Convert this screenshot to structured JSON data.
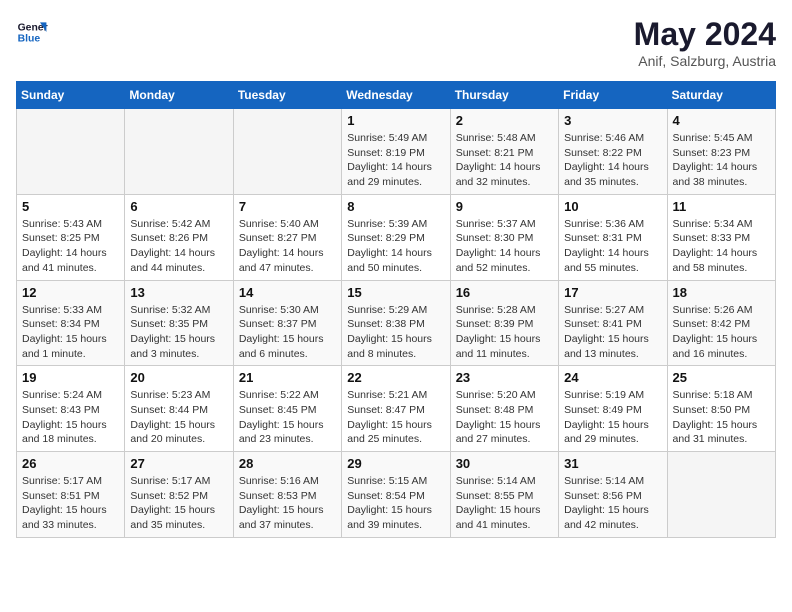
{
  "header": {
    "logo_line1": "General",
    "logo_line2": "Blue",
    "title": "May 2024",
    "subtitle": "Anif, Salzburg, Austria"
  },
  "days_of_week": [
    "Sunday",
    "Monday",
    "Tuesday",
    "Wednesday",
    "Thursday",
    "Friday",
    "Saturday"
  ],
  "weeks": [
    [
      {
        "day": "",
        "info": ""
      },
      {
        "day": "",
        "info": ""
      },
      {
        "day": "",
        "info": ""
      },
      {
        "day": "1",
        "info": "Sunrise: 5:49 AM\nSunset: 8:19 PM\nDaylight: 14 hours\nand 29 minutes."
      },
      {
        "day": "2",
        "info": "Sunrise: 5:48 AM\nSunset: 8:21 PM\nDaylight: 14 hours\nand 32 minutes."
      },
      {
        "day": "3",
        "info": "Sunrise: 5:46 AM\nSunset: 8:22 PM\nDaylight: 14 hours\nand 35 minutes."
      },
      {
        "day": "4",
        "info": "Sunrise: 5:45 AM\nSunset: 8:23 PM\nDaylight: 14 hours\nand 38 minutes."
      }
    ],
    [
      {
        "day": "5",
        "info": "Sunrise: 5:43 AM\nSunset: 8:25 PM\nDaylight: 14 hours\nand 41 minutes."
      },
      {
        "day": "6",
        "info": "Sunrise: 5:42 AM\nSunset: 8:26 PM\nDaylight: 14 hours\nand 44 minutes."
      },
      {
        "day": "7",
        "info": "Sunrise: 5:40 AM\nSunset: 8:27 PM\nDaylight: 14 hours\nand 47 minutes."
      },
      {
        "day": "8",
        "info": "Sunrise: 5:39 AM\nSunset: 8:29 PM\nDaylight: 14 hours\nand 50 minutes."
      },
      {
        "day": "9",
        "info": "Sunrise: 5:37 AM\nSunset: 8:30 PM\nDaylight: 14 hours\nand 52 minutes."
      },
      {
        "day": "10",
        "info": "Sunrise: 5:36 AM\nSunset: 8:31 PM\nDaylight: 14 hours\nand 55 minutes."
      },
      {
        "day": "11",
        "info": "Sunrise: 5:34 AM\nSunset: 8:33 PM\nDaylight: 14 hours\nand 58 minutes."
      }
    ],
    [
      {
        "day": "12",
        "info": "Sunrise: 5:33 AM\nSunset: 8:34 PM\nDaylight: 15 hours\nand 1 minute."
      },
      {
        "day": "13",
        "info": "Sunrise: 5:32 AM\nSunset: 8:35 PM\nDaylight: 15 hours\nand 3 minutes."
      },
      {
        "day": "14",
        "info": "Sunrise: 5:30 AM\nSunset: 8:37 PM\nDaylight: 15 hours\nand 6 minutes."
      },
      {
        "day": "15",
        "info": "Sunrise: 5:29 AM\nSunset: 8:38 PM\nDaylight: 15 hours\nand 8 minutes."
      },
      {
        "day": "16",
        "info": "Sunrise: 5:28 AM\nSunset: 8:39 PM\nDaylight: 15 hours\nand 11 minutes."
      },
      {
        "day": "17",
        "info": "Sunrise: 5:27 AM\nSunset: 8:41 PM\nDaylight: 15 hours\nand 13 minutes."
      },
      {
        "day": "18",
        "info": "Sunrise: 5:26 AM\nSunset: 8:42 PM\nDaylight: 15 hours\nand 16 minutes."
      }
    ],
    [
      {
        "day": "19",
        "info": "Sunrise: 5:24 AM\nSunset: 8:43 PM\nDaylight: 15 hours\nand 18 minutes."
      },
      {
        "day": "20",
        "info": "Sunrise: 5:23 AM\nSunset: 8:44 PM\nDaylight: 15 hours\nand 20 minutes."
      },
      {
        "day": "21",
        "info": "Sunrise: 5:22 AM\nSunset: 8:45 PM\nDaylight: 15 hours\nand 23 minutes."
      },
      {
        "day": "22",
        "info": "Sunrise: 5:21 AM\nSunset: 8:47 PM\nDaylight: 15 hours\nand 25 minutes."
      },
      {
        "day": "23",
        "info": "Sunrise: 5:20 AM\nSunset: 8:48 PM\nDaylight: 15 hours\nand 27 minutes."
      },
      {
        "day": "24",
        "info": "Sunrise: 5:19 AM\nSunset: 8:49 PM\nDaylight: 15 hours\nand 29 minutes."
      },
      {
        "day": "25",
        "info": "Sunrise: 5:18 AM\nSunset: 8:50 PM\nDaylight: 15 hours\nand 31 minutes."
      }
    ],
    [
      {
        "day": "26",
        "info": "Sunrise: 5:17 AM\nSunset: 8:51 PM\nDaylight: 15 hours\nand 33 minutes."
      },
      {
        "day": "27",
        "info": "Sunrise: 5:17 AM\nSunset: 8:52 PM\nDaylight: 15 hours\nand 35 minutes."
      },
      {
        "day": "28",
        "info": "Sunrise: 5:16 AM\nSunset: 8:53 PM\nDaylight: 15 hours\nand 37 minutes."
      },
      {
        "day": "29",
        "info": "Sunrise: 5:15 AM\nSunset: 8:54 PM\nDaylight: 15 hours\nand 39 minutes."
      },
      {
        "day": "30",
        "info": "Sunrise: 5:14 AM\nSunset: 8:55 PM\nDaylight: 15 hours\nand 41 minutes."
      },
      {
        "day": "31",
        "info": "Sunrise: 5:14 AM\nSunset: 8:56 PM\nDaylight: 15 hours\nand 42 minutes."
      },
      {
        "day": "",
        "info": ""
      }
    ]
  ]
}
